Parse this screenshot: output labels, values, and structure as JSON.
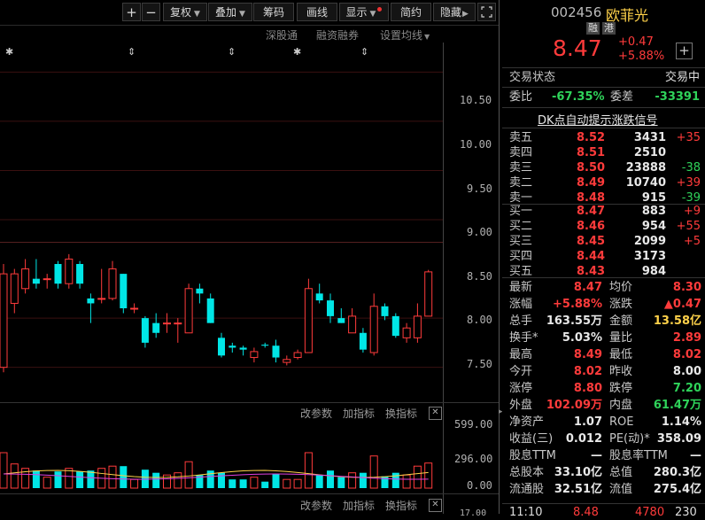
{
  "toolbar": {
    "plus": "+",
    "minus": "−",
    "fuquan": "复权",
    "diejia": "叠加",
    "chouma": "筹码",
    "huaxian": "画线",
    "xianshi": "显示",
    "jianyue": "简约",
    "yincang": "隐藏"
  },
  "subbar": {
    "shengutong": "深股通",
    "rongzi": "融资融券",
    "shezhi": "设置均线"
  },
  "markers": [
    "✱",
    "⇕",
    "⇕",
    "✱",
    "⇕"
  ],
  "axis": {
    "price_ticks": [
      "10.50",
      "10.00",
      "9.50",
      "9.00",
      "8.50",
      "8.00",
      "7.50"
    ],
    "volume_ticks": [
      "599.00",
      "296.00",
      "0.00"
    ],
    "bottom_tick": "17.00"
  },
  "indicator_bar": {
    "change_param": "改参数",
    "add_indicator": "加指标",
    "switch_indicator": "换指标",
    "close": "✕"
  },
  "indicator_bar2": {
    "change_param": "改参数",
    "add_indicator": "加指标",
    "switch_indicator": "换指标",
    "close": "✕"
  },
  "colors": {
    "up": "#ff3b3b",
    "down": "#00e6e6",
    "grid": "#3a1010"
  },
  "chart_data": {
    "type": "candlestick",
    "price_range": [
      7.2,
      10.8
    ],
    "candles": [
      {
        "o": 7.5,
        "h": 8.55,
        "l": 7.45,
        "c": 8.45
      },
      {
        "o": 8.15,
        "h": 8.5,
        "l": 8.05,
        "c": 8.45
      },
      {
        "o": 8.3,
        "h": 8.6,
        "l": 8.25,
        "c": 8.5
      },
      {
        "o": 8.4,
        "h": 8.6,
        "l": 8.3,
        "c": 8.35
      },
      {
        "o": 8.4,
        "h": 8.45,
        "l": 8.3,
        "c": 8.4
      },
      {
        "o": 8.55,
        "h": 8.58,
        "l": 8.3,
        "c": 8.35
      },
      {
        "o": 8.35,
        "h": 8.65,
        "l": 8.3,
        "c": 8.6
      },
      {
        "o": 8.55,
        "h": 8.58,
        "l": 8.3,
        "c": 8.35
      },
      {
        "o": 8.2,
        "h": 8.25,
        "l": 7.95,
        "c": 8.15
      },
      {
        "o": 8.2,
        "h": 8.5,
        "l": 8.15,
        "c": 8.2
      },
      {
        "o": 8.2,
        "h": 8.58,
        "l": 8.18,
        "c": 8.5
      },
      {
        "o": 8.45,
        "h": 8.45,
        "l": 8.05,
        "c": 8.1
      },
      {
        "o": 8.1,
        "h": 8.15,
        "l": 8.05,
        "c": 8.1
      },
      {
        "o": 8.0,
        "h": 8.02,
        "l": 7.7,
        "c": 7.75
      },
      {
        "o": 7.95,
        "h": 8.05,
        "l": 7.8,
        "c": 7.85
      },
      {
        "o": 7.95,
        "h": 8.05,
        "l": 7.85,
        "c": 7.95
      },
      {
        "o": 7.95,
        "h": 8.0,
        "l": 7.75,
        "c": 7.95
      },
      {
        "o": 7.85,
        "h": 8.35,
        "l": 7.85,
        "c": 8.3
      },
      {
        "o": 8.3,
        "h": 8.35,
        "l": 8.15,
        "c": 8.25
      },
      {
        "o": 8.2,
        "h": 8.25,
        "l": 7.95,
        "c": 7.95
      },
      {
        "o": 7.8,
        "h": 7.85,
        "l": 7.6,
        "c": 7.62
      },
      {
        "o": 7.72,
        "h": 7.75,
        "l": 7.65,
        "c": 7.7
      },
      {
        "o": 7.7,
        "h": 7.72,
        "l": 7.62,
        "c": 7.68
      },
      {
        "o": 7.6,
        "h": 7.7,
        "l": 7.55,
        "c": 7.66
      },
      {
        "o": 7.73,
        "h": 7.75,
        "l": 7.7,
        "c": 7.72
      },
      {
        "o": 7.72,
        "h": 7.78,
        "l": 7.55,
        "c": 7.6
      },
      {
        "o": 7.55,
        "h": 7.62,
        "l": 7.52,
        "c": 7.58
      },
      {
        "o": 7.6,
        "h": 7.68,
        "l": 7.58,
        "c": 7.65
      },
      {
        "o": 7.65,
        "h": 8.4,
        "l": 7.65,
        "c": 8.3
      },
      {
        "o": 8.25,
        "h": 8.35,
        "l": 8.15,
        "c": 8.18
      },
      {
        "o": 8.18,
        "h": 8.25,
        "l": 7.95,
        "c": 8.02
      },
      {
        "o": 8.0,
        "h": 8.1,
        "l": 7.95,
        "c": 7.95
      },
      {
        "o": 7.85,
        "h": 8.1,
        "l": 7.85,
        "c": 8.02
      },
      {
        "o": 7.85,
        "h": 7.9,
        "l": 7.65,
        "c": 7.68
      },
      {
        "o": 7.65,
        "h": 8.25,
        "l": 7.62,
        "c": 8.12
      },
      {
        "o": 8.12,
        "h": 8.15,
        "l": 7.98,
        "c": 8.02
      },
      {
        "o": 8.02,
        "h": 8.05,
        "l": 7.8,
        "c": 7.82
      },
      {
        "o": 7.8,
        "h": 7.95,
        "l": 7.75,
        "c": 7.9
      },
      {
        "o": 7.8,
        "h": 8.15,
        "l": 7.75,
        "c": 8.02
      },
      {
        "o": 8.02,
        "h": 8.49,
        "l": 8.02,
        "c": 8.47
      }
    ],
    "volume_range": [
      0,
      600
    ]
  },
  "panel": {
    "code": "002456",
    "name": "欧菲光",
    "tag1": "融",
    "tag2": "港",
    "price": "8.47",
    "change": "+0.47",
    "change_pct": "+5.88%",
    "add_icon": "+",
    "status_label": "交易状态",
    "status_value": "交易中",
    "weibi_label": "委比",
    "weibi_value": "-67.35%",
    "weicha_label": "委差",
    "weicha_value": "-33391",
    "dk_link": "DK点自动提示涨跌信号",
    "asks": [
      {
        "label": "卖五",
        "price": "8.52",
        "vol": "3431",
        "chg": "+35"
      },
      {
        "label": "卖四",
        "price": "8.51",
        "vol": "2510",
        "chg": ""
      },
      {
        "label": "卖三",
        "price": "8.50",
        "vol": "23888",
        "chg": "-38"
      },
      {
        "label": "卖二",
        "price": "8.49",
        "vol": "10740",
        "chg": "+39"
      },
      {
        "label": "卖一",
        "price": "8.48",
        "vol": "915",
        "chg": "-39"
      }
    ],
    "bids": [
      {
        "label": "买一",
        "price": "8.47",
        "vol": "883",
        "chg": "+9"
      },
      {
        "label": "买二",
        "price": "8.46",
        "vol": "954",
        "chg": "+55"
      },
      {
        "label": "买三",
        "price": "8.45",
        "vol": "2099",
        "chg": "+5"
      },
      {
        "label": "买四",
        "price": "8.44",
        "vol": "3173",
        "chg": ""
      },
      {
        "label": "买五",
        "price": "8.43",
        "vol": "984",
        "chg": ""
      }
    ],
    "stats": [
      {
        "l1": "最新",
        "v1": "8.47",
        "c1": "red",
        "l2": "均价",
        "v2": "8.30",
        "c2": "red"
      },
      {
        "l1": "涨幅",
        "v1": "+5.88%",
        "c1": "red",
        "l2": "涨跌",
        "v2": "▲0.47",
        "c2": "red"
      },
      {
        "l1": "总手",
        "v1": "163.55万",
        "c1": "white",
        "l2": "金额",
        "v2": "13.58亿",
        "c2": "yellow"
      },
      {
        "l1": "换手*",
        "v1": "5.03%",
        "c1": "white",
        "l2": "量比",
        "v2": "2.89",
        "c2": "red"
      },
      {
        "l1": "最高",
        "v1": "8.49",
        "c1": "red",
        "l2": "最低",
        "v2": "8.02",
        "c2": "red"
      },
      {
        "l1": "今开",
        "v1": "8.02",
        "c1": "red",
        "l2": "昨收",
        "v2": "8.00",
        "c2": "white"
      },
      {
        "l1": "涨停",
        "v1": "8.80",
        "c1": "red",
        "l2": "跌停",
        "v2": "7.20",
        "c2": "green"
      },
      {
        "l1": "外盘",
        "v1": "102.09万",
        "c1": "red",
        "l2": "内盘",
        "v2": "61.47万",
        "c2": "green"
      },
      {
        "l1": "净资产",
        "v1": "1.07",
        "c1": "white",
        "l2": "ROE",
        "v2": "1.14%",
        "c2": "white"
      },
      {
        "l1": "收益(三)",
        "v1": "0.012",
        "c1": "white",
        "l2": "PE(动)*",
        "v2": "358.09",
        "c2": "white"
      },
      {
        "l1": "股息TTM",
        "v1": "—",
        "c1": "white",
        "l2": "股息率TTM",
        "v2": "—",
        "c2": "white"
      },
      {
        "l1": "总股本",
        "v1": "33.10亿",
        "c1": "white",
        "l2": "总值",
        "v2": "280.3亿",
        "c2": "white"
      },
      {
        "l1": "流通股",
        "v1": "32.51亿",
        "c1": "white",
        "l2": "流值",
        "v2": "275.4亿",
        "c2": "white"
      }
    ],
    "tick": {
      "time": "11:10",
      "price": "8.48",
      "vol": "4780",
      "num": "230"
    }
  }
}
